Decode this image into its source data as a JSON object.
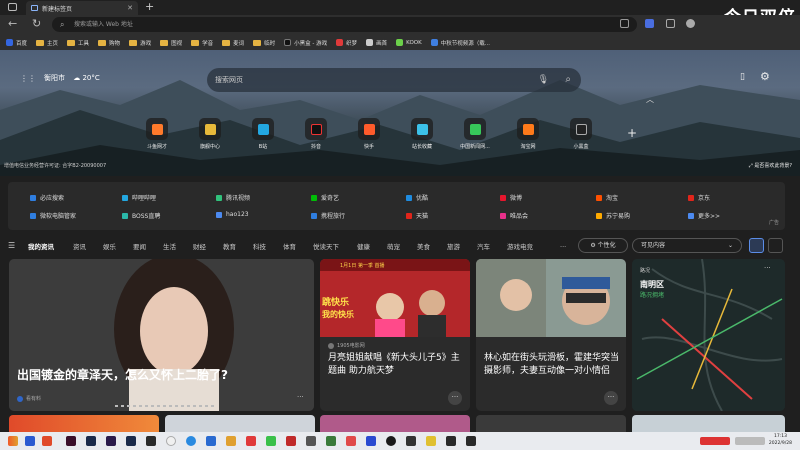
{
  "browser": {
    "tab_title": "新建标签页",
    "address_placeholder": "搜索或输入 Web 地址",
    "brand_watermark": "今日双倍"
  },
  "bookmarks": [
    "百度",
    "主页",
    "工具",
    "购物",
    "游戏",
    "图视",
    "学音",
    "麦词",
    "临时",
    "小黑盒 - 游戏",
    "织梦",
    "画首",
    "KOOK",
    "中秋节视频源（载..."
  ],
  "hero": {
    "city": "衡阳市",
    "temperature": "20°C",
    "search_placeholder": "搜索网页",
    "license": "增值电信业务经营许可证: 合字B2-20090007",
    "image_info": "是否喜欢此背景?",
    "shortcuts": [
      {
        "label": "斗鱼网才",
        "color": "#ff7a2b"
      },
      {
        "label": "旗舰中心",
        "color": "#e8b93a"
      },
      {
        "label": "B站",
        "color": "#23a7e0"
      },
      {
        "label": "抖音",
        "color": "#222222"
      },
      {
        "label": "快手",
        "color": "#ff5b2b"
      },
      {
        "label": "站长收藏",
        "color": "#3cc1e8"
      },
      {
        "label": "中国新闻网...",
        "color": "#37c85a"
      },
      {
        "label": "淘宝网",
        "color": "#ff7a1a"
      },
      {
        "label": "小黑盒",
        "color": "#222222"
      }
    ]
  },
  "quick_links": {
    "row1": [
      {
        "label": "必应搜索",
        "color": "#2f7ee0"
      },
      {
        "label": "哔哩哔哩",
        "color": "#23a7e0"
      },
      {
        "label": "腾讯视频",
        "color": "#31c27c"
      },
      {
        "label": "爱奇艺",
        "color": "#00be06"
      },
      {
        "label": "优酷",
        "color": "#1f8ce0"
      },
      {
        "label": "微博",
        "color": "#e6162d"
      },
      {
        "label": "淘宝",
        "color": "#ff5000"
      },
      {
        "label": "京东",
        "color": "#e1251b"
      }
    ],
    "row2": [
      {
        "label": "微软电脑管家",
        "color": "#2f7ee0"
      },
      {
        "label": "BOSS直聘",
        "color": "#2bb8a9"
      },
      {
        "label": "hao123",
        "color": "#4c8af0"
      },
      {
        "label": "携程旅行",
        "color": "#2f7ee0"
      },
      {
        "label": "天猫",
        "color": "#e1251b"
      },
      {
        "label": "唯品会",
        "color": "#e8308a"
      },
      {
        "label": "苏宁易购",
        "color": "#ffaa00"
      },
      {
        "label": "更多>>",
        "color": "#4c8af0"
      }
    ],
    "ad_label": "广告"
  },
  "news_nav": {
    "items": [
      "我的资讯",
      "资讯",
      "娱乐",
      "要闻",
      "生活",
      "财经",
      "教育",
      "科技",
      "体育",
      "悦读天下",
      "健康",
      "萌宠",
      "美食",
      "旅游",
      "汽车",
      "游戏电竞"
    ],
    "more": "...",
    "personalize": "个性化",
    "visibility": "可见内容"
  },
  "cards": [
    {
      "title": "出国镀金的章泽天，怎么又怀上二胎了?",
      "source": "看有料"
    },
    {
      "title": "月亮姐姐献唱《新大头儿子5》主题曲 助力航天梦",
      "source": "1905电影网",
      "banner": "1月1日 第一季 首播",
      "tag1": "跳快乐",
      "tag2": "我的快乐"
    },
    {
      "title": "林心如在街头玩滑板，霍建华突当摄影师，夫妻互动像一对小情侣",
      "source": "看有料"
    },
    {
      "title": "南明区",
      "subtitle": "路况拥堵",
      "heading": "路况"
    }
  ],
  "clock": {
    "time": "17:13",
    "date": "2022/9/28"
  }
}
